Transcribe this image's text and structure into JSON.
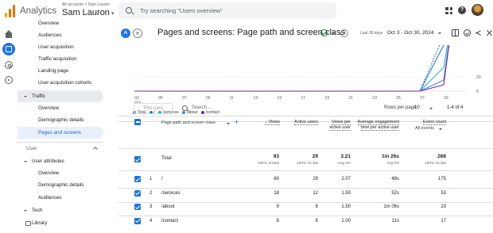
{
  "topbar": {
    "app_title": "Analytics",
    "account_breadcrumb": "All accounts > Sam Lauron",
    "account_name": "Sam Lauron",
    "search_placeholder": "Try searching \"Users overview\"",
    "icons": [
      "apps-icon",
      "help-icon",
      "avatar"
    ]
  },
  "nav": {
    "items": [
      {
        "label": "Overview"
      },
      {
        "label": "Audiences"
      },
      {
        "label": "User acquisition"
      },
      {
        "label": "Traffic acquisition"
      },
      {
        "label": "Landing page"
      },
      {
        "label": "User acquisition cohorts"
      },
      {
        "label": "Traffic"
      },
      {
        "label": "Overview"
      },
      {
        "label": "Demographic details"
      },
      {
        "label": "Pages and screens"
      }
    ],
    "user_section": "User",
    "user_items": [
      {
        "label": "User attributes"
      },
      {
        "label": "Overview"
      },
      {
        "label": "Demographic details"
      },
      {
        "label": "Audiences"
      },
      {
        "label": "Tech"
      },
      {
        "label": "Library"
      }
    ]
  },
  "report": {
    "badge": "A",
    "title": "Pages and screens: Page path and screen class",
    "date_label": "Last 28 days",
    "date_range": "Oct 3 - Oct 30, 2024"
  },
  "chart_data": {
    "type": "line",
    "x_ticks": [
      "03",
      "05",
      "07",
      "09",
      "11",
      "13",
      "15",
      "17",
      "19",
      "21",
      "23",
      "25",
      "27",
      "29"
    ],
    "x_month_label": "Oct",
    "y_ticks": [
      "20",
      "0"
    ],
    "series": [
      {
        "name": "Total",
        "color": "#1a73e8",
        "style": "dashed"
      },
      {
        "name": "/",
        "color": "#1a73e8",
        "style": "solid"
      },
      {
        "name": "/services",
        "color": "#12b5cb",
        "style": "solid"
      },
      {
        "name": "/about",
        "color": "#4285f4",
        "style": "solid"
      },
      {
        "name": "/contact",
        "color": "#7b1fa2",
        "style": "solid"
      }
    ]
  },
  "legend": {
    "total": "Total",
    "s1": "/",
    "s2": "/services",
    "s3": "/about",
    "s4": "/contact"
  },
  "table_controls": {
    "plot_rows": "Plot rows",
    "search_placeholder": "Search...",
    "rows_per_page_label": "Rows per page:",
    "rows_per_page": "10",
    "range": "1-4 of 4"
  },
  "table": {
    "dimension_header": "Page path and screen class",
    "columns": [
      {
        "label": "Views",
        "arrow": "↓"
      },
      {
        "label": "Active users"
      },
      {
        "label": "Views per active user"
      },
      {
        "label": "Average engagement time per active user"
      },
      {
        "label": "Event count"
      }
    ],
    "event_select": "All events",
    "total": {
      "label": "Total",
      "views": "93",
      "views_sub": "100% of total",
      "users": "29",
      "users_sub": "100% of total",
      "vpu": "3.21",
      "vpu_sub": "Avg 0%",
      "avg_time": "1m 26s",
      "avg_time_sub": "Avg 0%",
      "events": "268",
      "events_sub": "100% of total"
    },
    "rows": [
      {
        "n": "1",
        "path": "/",
        "views": "60",
        "users": "29",
        "vpu": "2.07",
        "time": "48s",
        "events": "175"
      },
      {
        "n": "2",
        "path": "/services",
        "views": "18",
        "users": "12",
        "vpu": "1.50",
        "time": "52s",
        "events": "53"
      },
      {
        "n": "3",
        "path": "/about",
        "views": "9",
        "users": "6",
        "vpu": "1.50",
        "time": "1m 06s",
        "events": "23"
      },
      {
        "n": "4",
        "path": "/contact",
        "views": "6",
        "users": "6",
        "vpu": "1.00",
        "time": "11s",
        "events": "17"
      }
    ]
  }
}
